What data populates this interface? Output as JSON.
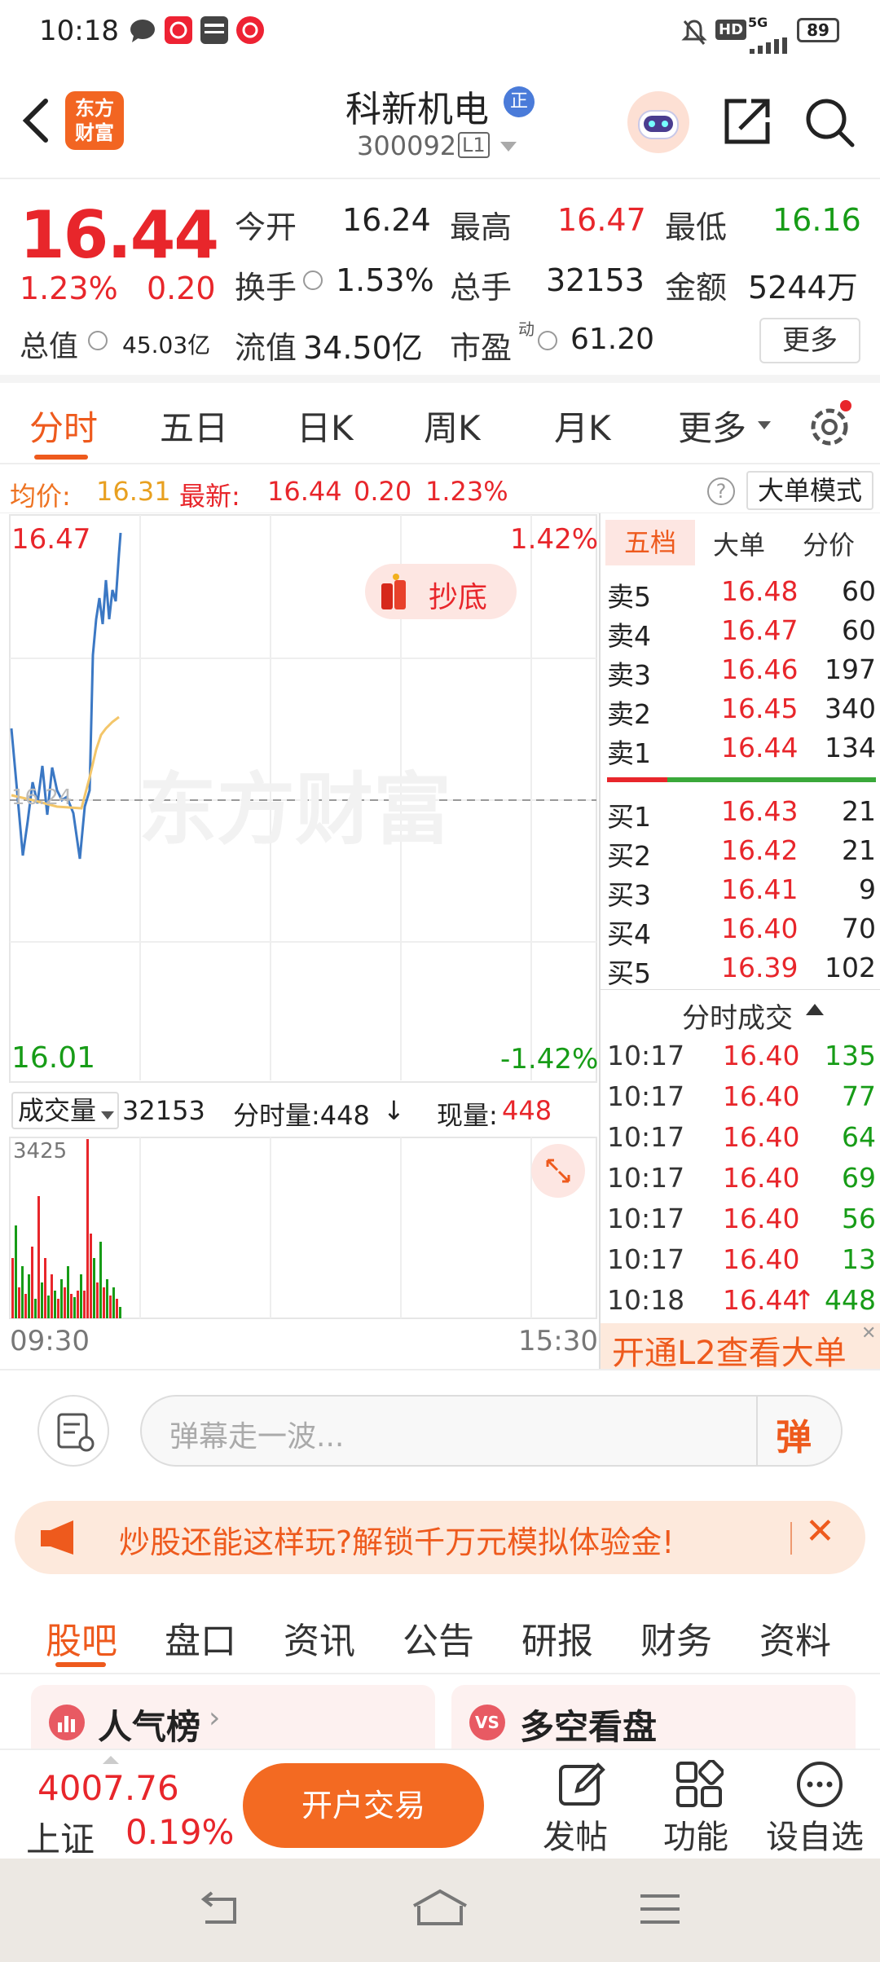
{
  "status": {
    "time": "10:18",
    "network": "5G",
    "battery": "89",
    "hd": "HD"
  },
  "header": {
    "logo_line1": "东方",
    "logo_line2": "财富",
    "title": "科新机电",
    "badge": "正",
    "code": "300092",
    "level": "L1"
  },
  "quote": {
    "price": "16.44",
    "change_pct": "1.23%",
    "change": "0.20",
    "open_label": "今开",
    "open": "16.24",
    "high_label": "最高",
    "high": "16.47",
    "low_label": "最低",
    "low": "16.16",
    "turnover_label": "换手",
    "turnover": "1.53%",
    "volume_label": "总手",
    "volume": "32153",
    "amount_label": "金额",
    "amount": "5244万",
    "mktcap_label": "总值",
    "mktcap": "45.03亿",
    "float_label": "流值",
    "float_cap": "34.50亿",
    "pe_label": "市盈",
    "pe_sup": "动",
    "pe": "61.20",
    "more": "更多"
  },
  "tabs": [
    "分时",
    "五日",
    "日K",
    "周K",
    "月K",
    "更多"
  ],
  "avgbar": {
    "avg_label": "均价:",
    "avg": "16.31",
    "latest_label": "最新:",
    "latest": "16.44",
    "chg": "0.20",
    "pct": "1.23%",
    "bigmode": "大单模式",
    "help": "?"
  },
  "chart": {
    "y_max": "16.47",
    "y_min": "16.01",
    "pct_max": "1.42%",
    "pct_min": "-1.42%",
    "prev_close_label": "16.24",
    "watermark": "东方财富",
    "promo": "抄底",
    "vol_label": "成交量",
    "vol_total": "32153",
    "minute_vol": "分时量:448",
    "cur_vol_label": "现量:",
    "cur_vol": "448",
    "vol_max": "3425",
    "time_start": "09:30",
    "time_end": "15:30"
  },
  "chart_data": {
    "type": "line",
    "x_range": [
      "09:30",
      "15:30"
    ],
    "ylim": [
      16.01,
      16.47
    ],
    "prev_close": 16.24,
    "series": [],
    "vol_max": 3425
  },
  "orderbook": {
    "tabs": [
      "五档",
      "大单",
      "分价"
    ],
    "asks": [
      {
        "label": "卖5",
        "price": "16.48",
        "vol": "60"
      },
      {
        "label": "卖4",
        "price": "16.47",
        "vol": "60"
      },
      {
        "label": "卖3",
        "price": "16.46",
        "vol": "197"
      },
      {
        "label": "卖2",
        "price": "16.45",
        "vol": "340"
      },
      {
        "label": "卖1",
        "price": "16.44",
        "vol": "134"
      }
    ],
    "bids": [
      {
        "label": "买1",
        "price": "16.43",
        "vol": "21"
      },
      {
        "label": "买2",
        "price": "16.42",
        "vol": "21"
      },
      {
        "label": "买3",
        "price": "16.41",
        "vol": "9"
      },
      {
        "label": "买4",
        "price": "16.40",
        "vol": "70"
      },
      {
        "label": "买5",
        "price": "16.39",
        "vol": "102"
      }
    ],
    "trades_title": "分时成交",
    "trades": [
      {
        "t": "10:17",
        "p": "16.40",
        "v": "135"
      },
      {
        "t": "10:17",
        "p": "16.40",
        "v": "77"
      },
      {
        "t": "10:17",
        "p": "16.40",
        "v": "64"
      },
      {
        "t": "10:17",
        "p": "16.40",
        "v": "69"
      },
      {
        "t": "10:17",
        "p": "16.40",
        "v": "56"
      },
      {
        "t": "10:17",
        "p": "16.40",
        "v": "13"
      },
      {
        "t": "10:18",
        "p": "16.44",
        "v": "448"
      }
    ],
    "l2_banner": "开通L2查看大单"
  },
  "danmaku": {
    "placeholder": "弹幕走一波...",
    "btn": "弹"
  },
  "ad": {
    "text": "炒股还能这样玩?解锁千万元模拟体验金!"
  },
  "tabs2": [
    "股吧",
    "盘口",
    "资讯",
    "公告",
    "研报",
    "财务",
    "资料"
  ],
  "cards": {
    "left": "人气榜",
    "right": "多空看盘"
  },
  "bottom": {
    "index_value": "4007.76",
    "index_name": "上证",
    "index_pct": "0.19%",
    "trade_btn": "开户交易",
    "post": "发帖",
    "func": "功能",
    "watch": "设自选"
  }
}
